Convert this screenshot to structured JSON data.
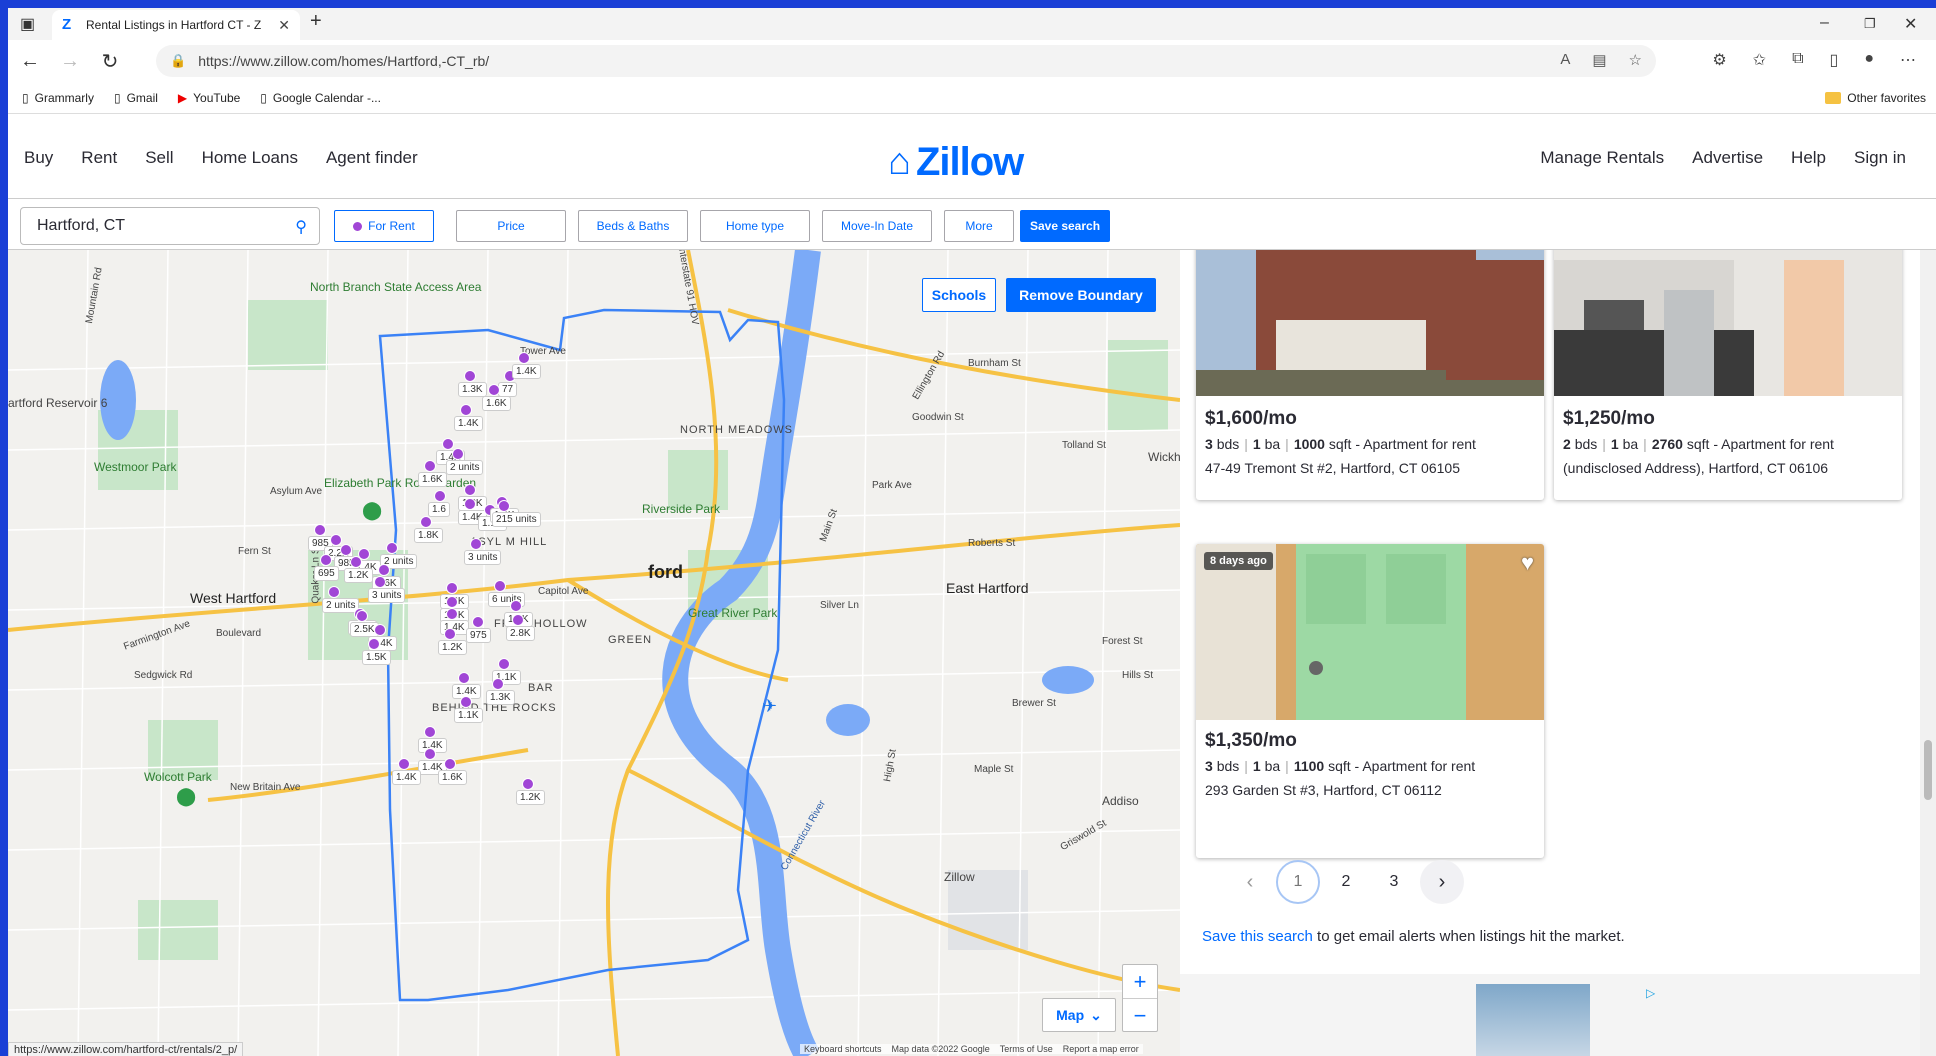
{
  "browser": {
    "tab_title": "Rental Listings in Hartford CT - Z",
    "url": "https://www.zillow.com/homes/Hartford,-CT_rb/",
    "bookmarks": [
      "Grammarly",
      "Gmail",
      "YouTube",
      "Google Calendar -..."
    ],
    "other_favorites": "Other favorites",
    "status_url": "https://www.zillow.com/hartford-ct/rentals/2_p/"
  },
  "header": {
    "left_nav": [
      "Buy",
      "Rent",
      "Sell",
      "Home Loans",
      "Agent finder"
    ],
    "logo": "Zillow",
    "right_nav": [
      "Manage Rentals",
      "Advertise",
      "Help",
      "Sign in"
    ]
  },
  "filters": {
    "search_value": "Hartford, CT",
    "for_rent": "For Rent",
    "price": "Price",
    "beds_baths": "Beds & Baths",
    "home_type": "Home type",
    "move_in": "Move-In Date",
    "more": "More",
    "save_search": "Save search"
  },
  "map": {
    "schools": "Schools",
    "remove_boundary": "Remove Boundary",
    "map_type": "Map",
    "zoom_in": "+",
    "zoom_out": "−",
    "attribution": [
      "Keyboard shortcuts",
      "Map data ©2022 Google",
      "Terms of Use",
      "Report a map error"
    ],
    "places": {
      "north_branch": "North Branch State Access Area",
      "reservoir": "artford Reservoir 6",
      "westmoor": "Westmoor Park",
      "elizabeth": "Elizabeth Park Rose Garden",
      "west_hartford": "West Hartford",
      "hartford": "ford",
      "north_meadows": "NORTH MEADOWS",
      "riverside": "Riverside Park",
      "great_river": "Great River Park",
      "east_hartford": "East Hartford",
      "behind_rocks": "BEHIND THE ROCKS",
      "wolcott": "Wolcott Park",
      "zillow_place": "Zillow",
      "wickh": "Wickh",
      "addiso": "Addiso",
      "asylum_hill": "ASYL M HILL",
      "frog_hollow": "FROG HOLLOW",
      "green": "GREEN",
      "bar": "BAR",
      "connecticut_river": "Connecticut River"
    },
    "roads": {
      "tower_ave": "Tower Ave",
      "asylum_ave": "Asylum Ave",
      "farmington_ave": "Farmington Ave",
      "boulevard": "Boulevard",
      "fern_st": "Fern St",
      "park_ave": "Park Ave",
      "burnham_st": "Burnham St",
      "silver_ln": "Silver Ln",
      "roberts_st": "Roberts St",
      "brewer_st": "Brewer St",
      "main_st": "Main St",
      "new_britain_ave": "New Britain Ave",
      "sedgwick_rd": "Sedgwick Rd",
      "capitol_ave": "Capitol Ave",
      "maple_st": "Maple St",
      "hills_st": "Hills St",
      "forest_st": "Forest St",
      "tolland_st": "Tolland St",
      "goodwin_st": "Goodwin St",
      "ellington_rd": "Ellington Rd",
      "mountain_rd": "Mountain Rd",
      "quaker_ln": "Quaker Ln S",
      "high_st": "High St",
      "griswold_st": "Griswold St",
      "i91_label": "Interstate 91 HOV"
    },
    "price_labels": [
      "1.3K",
      "77",
      "1.6K",
      "1.4K",
      "1.4K",
      "1.4K",
      "2 units",
      "1.2K",
      "1.6K",
      "1.6",
      "1.4K",
      "1.1K",
      "1.4K",
      "215 units",
      "1.8K",
      "985",
      "1.4K",
      "2 units",
      "3 units",
      "1.6K",
      "2.2K",
      "985",
      "1.2K",
      "695",
      "3 units",
      "6 units",
      "1.6K",
      "1.4K",
      "1.7K",
      "2 units",
      "1.4K",
      "975",
      "1.7K",
      "2.5K",
      "1.4K",
      "2.8K",
      "1.5K",
      "1.2K",
      "1.1K",
      "1.4K",
      "1.3K",
      "1.1K",
      "1.4K",
      "1.4K",
      "1.4K",
      "1.6K",
      "1.2K"
    ]
  },
  "listings": [
    {
      "price": "$1,600/mo",
      "beds": "3",
      "baths": "1",
      "sqft": "1000",
      "type": "Apartment for rent",
      "address": "47-49 Tremont St #2, Hartford, CT 06105"
    },
    {
      "price": "$1,250/mo",
      "beds": "2",
      "baths": "1",
      "sqft": "2760",
      "type": "Apartment for rent",
      "address": "(undisclosed Address), Hartford, CT 06106"
    },
    {
      "price": "$1,350/mo",
      "beds": "3",
      "baths": "1",
      "sqft": "1100",
      "type": "Apartment for rent",
      "address": "293 Garden St #3, Hartford, CT 06112",
      "badge": "8 days ago"
    }
  ],
  "units": {
    "bds": "bds",
    "ba": "ba",
    "sqft": "sqft"
  },
  "pagination": {
    "pages": [
      "1",
      "2",
      "3"
    ],
    "current": "1"
  },
  "save_alert": {
    "link": "Save this search",
    "text": " to get email alerts when listings hit the market."
  },
  "colors": {
    "brand": "#006aff",
    "pin": "#a146d6",
    "boundary": "#3b82f6",
    "water": "#7baaf7",
    "park": "#c8e6c9",
    "highway": "#f6c244"
  }
}
